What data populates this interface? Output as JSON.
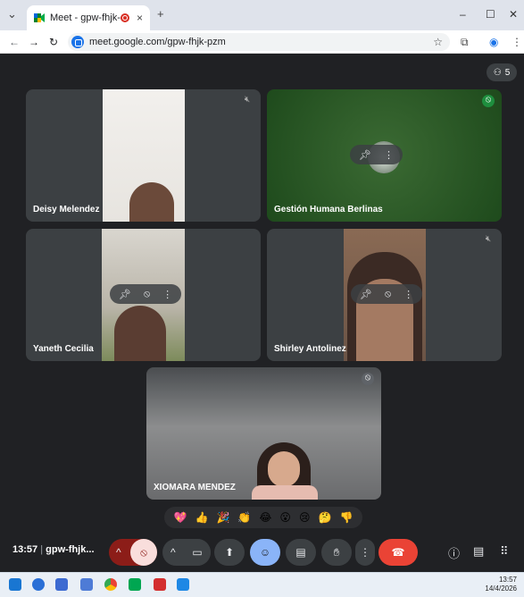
{
  "browser": {
    "tab_title": "Meet - gpw-fhjk-pzm",
    "tab_close": "×",
    "new_tab": "+",
    "url": "meet.google.com/gpw-fhjk-pzm"
  },
  "meeting": {
    "time": "13:57",
    "code": "gpw-fhjk...",
    "participant_count": "5",
    "participants": [
      {
        "name": "Deisy Melendez"
      },
      {
        "name": "Gestión Humana Berlinas"
      },
      {
        "name": "Yaneth Cecilia"
      },
      {
        "name": "Shirley Antolinez"
      },
      {
        "name": "XIOMARA MENDEZ"
      }
    ]
  },
  "reactions": [
    "💖",
    "👍",
    "🎉",
    "👏",
    "😂",
    "😮",
    "😢",
    "🤔",
    "👎"
  ],
  "taskbar": {
    "time": "13:57",
    "date": "14/4/2026"
  },
  "colors": {
    "leave": "#ea4335",
    "mic_off": "#f9dedc",
    "emoji_active": "#8ab4f8",
    "bg": "#202124",
    "tile": "#3c4043"
  }
}
